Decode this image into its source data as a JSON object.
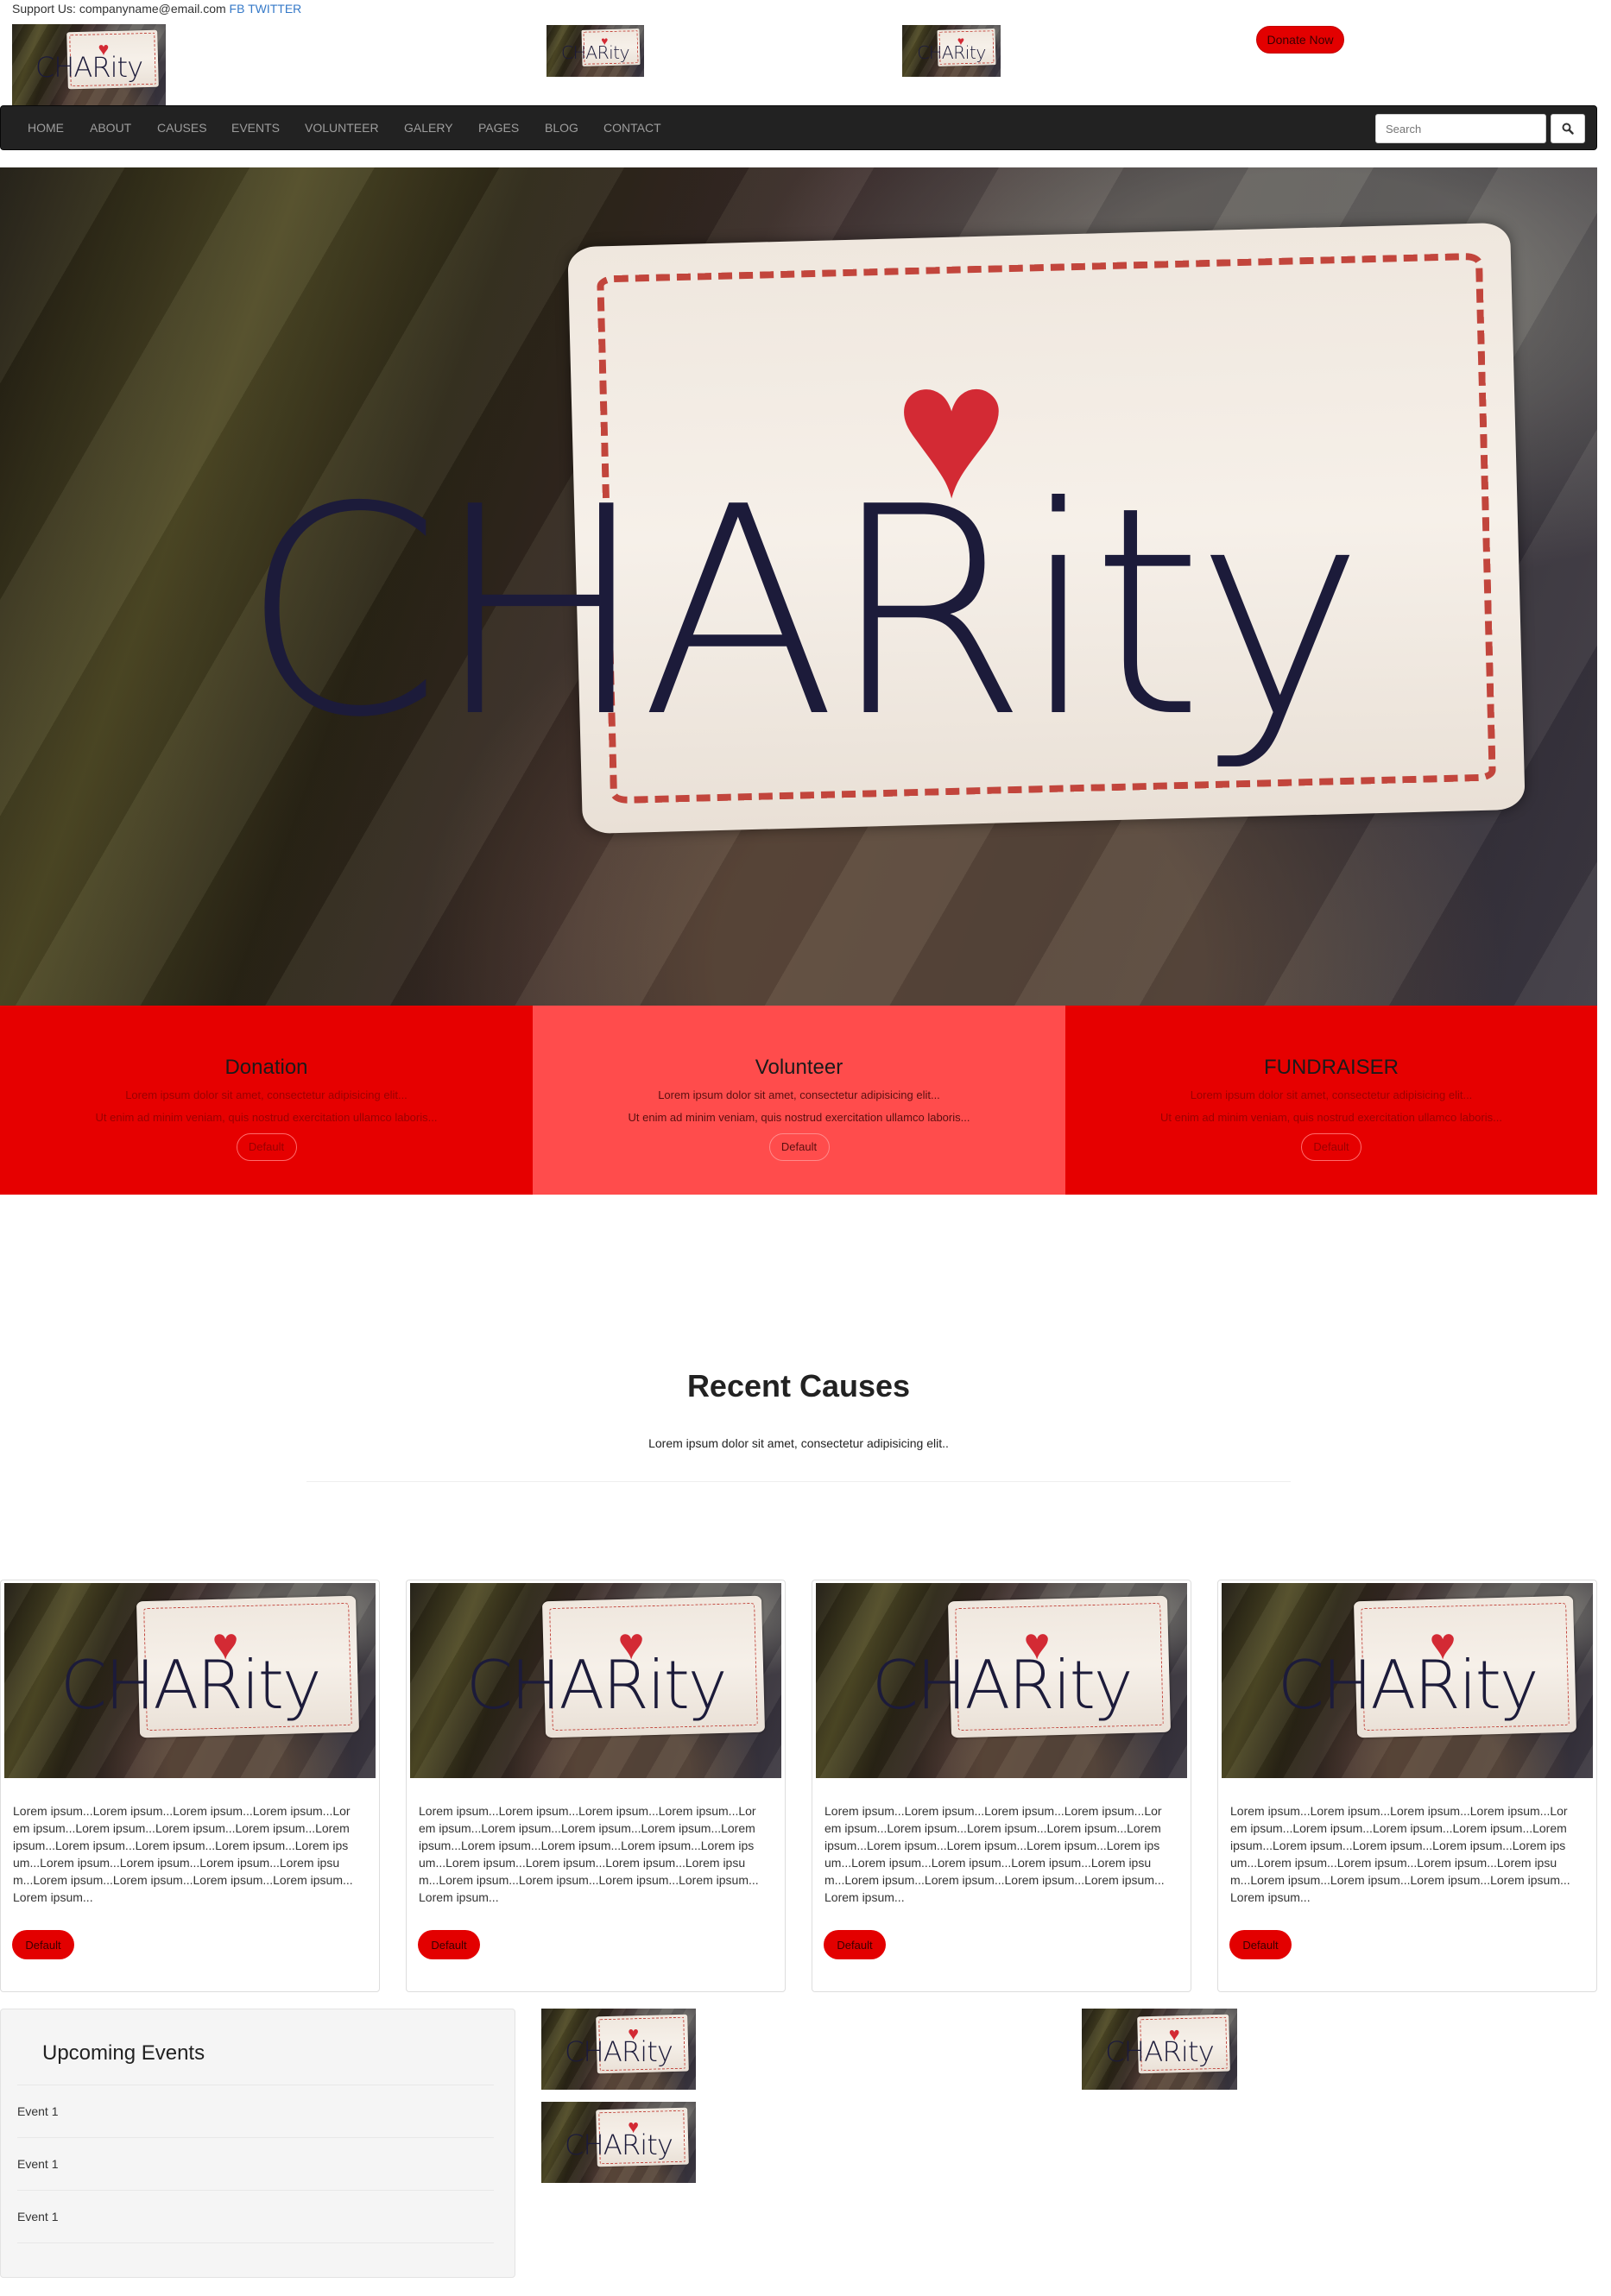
{
  "topbar": {
    "support_label": "Support Us: companyname@email.com",
    "fb_link": "FB",
    "twitter_link": "TWITTER",
    "donate_label": "Donate Now"
  },
  "jar_image": {
    "label_text": "CHARity",
    "heart": "♥"
  },
  "nav": {
    "items": [
      "HOME",
      "ABOUT",
      "CAUSES",
      "EVENTS",
      "VOLUNTEER",
      "GALERY",
      "PAGES",
      "BLOG",
      "CONTACT"
    ],
    "search_placeholder": "Search"
  },
  "features": [
    {
      "title": "Donation",
      "line1": "Lorem ipsum dolor sit amet, consectetur adipisicing elit...",
      "line2": "Ut enim ad minim veniam, quis nostrud exercitation ullamco laboris...",
      "button": "Default"
    },
    {
      "title": "Volunteer",
      "line1": "Lorem ipsum dolor sit amet, consectetur adipisicing elit...",
      "line2": "Ut enim ad minim veniam, quis nostrud exercitation ullamco laboris...",
      "button": "Default"
    },
    {
      "title": "FUNDRAISER",
      "line1": "Lorem ipsum dolor sit amet, consectetur adipisicing elit...",
      "line2": "Ut enim ad minim veniam, quis nostrud exercitation ullamco laboris...",
      "button": "Default"
    }
  ],
  "recent_causes": {
    "title": "Recent Causes",
    "subtitle": "Lorem ipsum dolor sit amet, consectetur adipisicing elit..",
    "cards": [
      {
        "text": "Lorem ipsum...Lorem ipsum...Lorem ipsum...Lorem ipsum...Lorem ipsum...Lorem ipsum...Lorem ipsum...Lorem ipsum...Lorem ipsum...Lorem ipsum...Lorem ipsum...Lorem ipsum...Lorem ipsum...Lorem ipsum...Lorem ipsum...Lorem ipsum...Lorem ipsum...Lorem ipsum...Lorem ipsum...Lorem ipsum...Lorem ipsum...Lorem ipsum...",
        "button": "Default"
      },
      {
        "text": "Lorem ipsum...Lorem ipsum...Lorem ipsum...Lorem ipsum...Lorem ipsum...Lorem ipsum...Lorem ipsum...Lorem ipsum...Lorem ipsum...Lorem ipsum...Lorem ipsum...Lorem ipsum...Lorem ipsum...Lorem ipsum...Lorem ipsum...Lorem ipsum...Lorem ipsum...Lorem ipsum...Lorem ipsum...Lorem ipsum...Lorem ipsum...Lorem ipsum...",
        "button": "Default"
      },
      {
        "text": "Lorem ipsum...Lorem ipsum...Lorem ipsum...Lorem ipsum...Lorem ipsum...Lorem ipsum...Lorem ipsum...Lorem ipsum...Lorem ipsum...Lorem ipsum...Lorem ipsum...Lorem ipsum...Lorem ipsum...Lorem ipsum...Lorem ipsum...Lorem ipsum...Lorem ipsum...Lorem ipsum...Lorem ipsum...Lorem ipsum...Lorem ipsum...Lorem ipsum...",
        "button": "Default"
      },
      {
        "text": "Lorem ipsum...Lorem ipsum...Lorem ipsum...Lorem ipsum...Lorem ipsum...Lorem ipsum...Lorem ipsum...Lorem ipsum...Lorem ipsum...Lorem ipsum...Lorem ipsum...Lorem ipsum...Lorem ipsum...Lorem ipsum...Lorem ipsum...Lorem ipsum...Lorem ipsum...Lorem ipsum...Lorem ipsum...Lorem ipsum...Lorem ipsum...Lorem ipsum...",
        "button": "Default"
      }
    ]
  },
  "events": {
    "title": "Upcoming Events",
    "items": [
      "Event 1",
      "Event 1",
      "Event 1"
    ]
  },
  "colors": {
    "brand_red": "#e60000",
    "light_red": "#ff4c4c",
    "navbar": "#222222"
  }
}
